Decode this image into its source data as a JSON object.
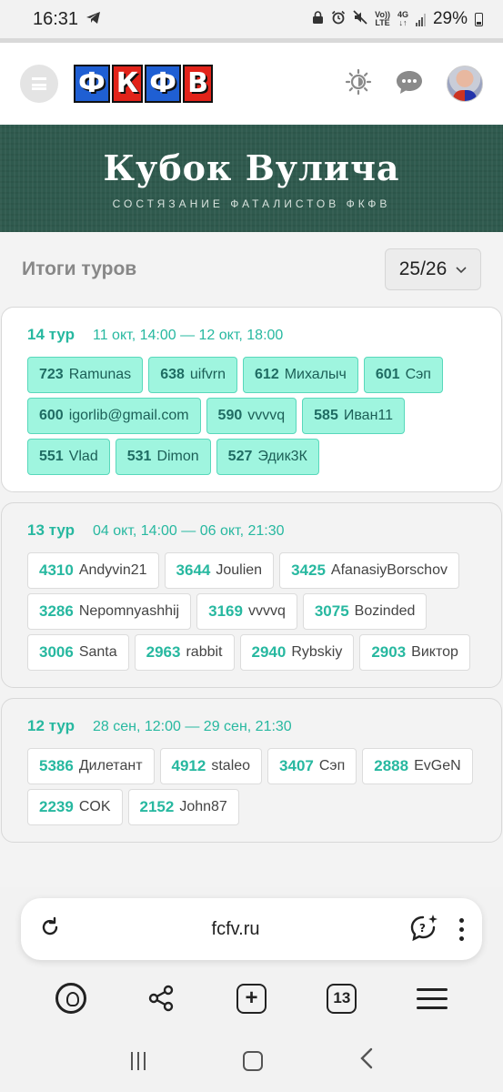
{
  "status_bar": {
    "time": "16:31",
    "network": "4G",
    "volte": "Vo)) LTE",
    "battery": "29%"
  },
  "header": {
    "logo_letters": [
      "Ф",
      "К",
      "Ф",
      "В"
    ],
    "icons": [
      "menu-icon",
      "theme-toggle-icon",
      "chat-icon",
      "avatar"
    ]
  },
  "banner": {
    "title": "Кубок Вулича",
    "subtitle": "СОСТЯЗАНИЕ ФАТАЛИСТОВ ФКФВ"
  },
  "results": {
    "heading": "Итоги туров",
    "season": "25/26"
  },
  "rounds": [
    {
      "title": "14 тур",
      "dates": "11 окт, 14:00 — 12 окт, 18:00",
      "current": true,
      "entries": [
        {
          "points": "723",
          "name": "Ramunas"
        },
        {
          "points": "638",
          "name": "uifvrn"
        },
        {
          "points": "612",
          "name": "Михалыч"
        },
        {
          "points": "601",
          "name": "Сэп"
        },
        {
          "points": "600",
          "name": "igorlib@gmail.com"
        },
        {
          "points": "590",
          "name": "vvvvq"
        },
        {
          "points": "585",
          "name": "Иван11"
        },
        {
          "points": "551",
          "name": "Vlad"
        },
        {
          "points": "531",
          "name": "Dimon"
        },
        {
          "points": "527",
          "name": "Эдик3К"
        }
      ]
    },
    {
      "title": "13 тур",
      "dates": "04 окт, 14:00 — 06 окт, 21:30",
      "current": false,
      "entries": [
        {
          "points": "4310",
          "name": "Andyvin21"
        },
        {
          "points": "3644",
          "name": "Joulien"
        },
        {
          "points": "3425",
          "name": "AfanasiyBorschov"
        },
        {
          "points": "3286",
          "name": "Nepomnyashhij"
        },
        {
          "points": "3169",
          "name": "vvvvq"
        },
        {
          "points": "3075",
          "name": "Bozinded"
        },
        {
          "points": "3006",
          "name": "Santa"
        },
        {
          "points": "2963",
          "name": "rabbit"
        },
        {
          "points": "2940",
          "name": "Rybskiy"
        },
        {
          "points": "2903",
          "name": "Виктор"
        }
      ]
    },
    {
      "title": "12 тур",
      "dates": "28 сен, 12:00 — 29 сен, 21:30",
      "current": false,
      "entries": [
        {
          "points": "5386",
          "name": "Дилетант"
        },
        {
          "points": "4912",
          "name": "staleo"
        },
        {
          "points": "3407",
          "name": "Сэп"
        },
        {
          "points": "2888",
          "name": "EvGeN"
        },
        {
          "points": "2239",
          "name": "COK"
        },
        {
          "points": "2152",
          "name": "John87"
        }
      ]
    }
  ],
  "browser": {
    "url": "fcfv.ru",
    "tabs_count": "13",
    "icons": [
      "reload-icon",
      "ai-chat-icon",
      "more-icon",
      "alice-icon",
      "share-icon",
      "new-tab-icon",
      "tabs-icon",
      "menu-icon"
    ]
  },
  "system_nav": {
    "icons": [
      "recent-apps-icon",
      "home-icon",
      "back-icon"
    ]
  }
}
